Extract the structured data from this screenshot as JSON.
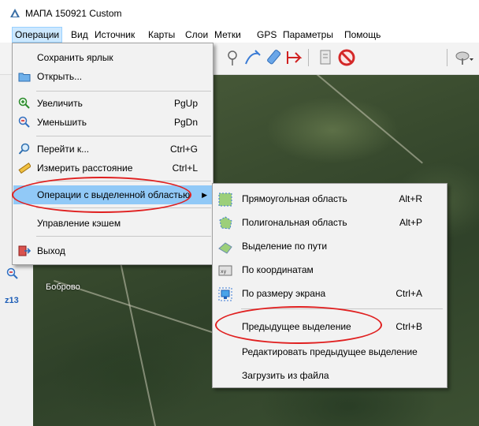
{
  "window": {
    "title": "МАПА 150921 Custom"
  },
  "menubar": {
    "items": [
      "Операции",
      "Вид",
      "Источник",
      "Карты",
      "Слои",
      "Метки",
      "GPS",
      "Параметры",
      "Помощь"
    ]
  },
  "toolbar": {
    "icons": [
      "pin-icon",
      "pen-route-icon",
      "highlighter-icon",
      "ruler-path-icon",
      "doc-icon",
      "no-icon",
      "satellite-icon"
    ]
  },
  "left_panel": {
    "zoom_label": "z13"
  },
  "map": {
    "place_label": "Боброво"
  },
  "operations_menu": {
    "items": [
      {
        "label": "Сохранить ярлык",
        "shortcut": "",
        "icon": ""
      },
      {
        "label": "Открыть...",
        "shortcut": "",
        "icon": "folder-icon"
      },
      {
        "label": "Увеличить",
        "shortcut": "PgUp",
        "icon": "zoom-in-icon"
      },
      {
        "label": "Уменьшить",
        "shortcut": "PgDn",
        "icon": "zoom-out-icon"
      },
      {
        "label": "Перейти к...",
        "shortcut": "Ctrl+G",
        "icon": "search-icon"
      },
      {
        "label": "Измерить расстояние",
        "shortcut": "Ctrl+L",
        "icon": "ruler-icon"
      },
      {
        "label": "Операции с выделенной областью",
        "shortcut": "",
        "icon": "",
        "submenu_arrow": "▶"
      },
      {
        "label": "Управление кэшем",
        "shortcut": "",
        "icon": ""
      },
      {
        "label": "Выход",
        "shortcut": "",
        "icon": "exit-icon"
      }
    ]
  },
  "selection_submenu": {
    "items": [
      {
        "label": "Прямоугольная область",
        "shortcut": "Alt+R",
        "icon": "rect-area-icon"
      },
      {
        "label": "Полигональная область",
        "shortcut": "Alt+P",
        "icon": "polygon-area-icon"
      },
      {
        "label": "Выделение по пути",
        "shortcut": "",
        "icon": "path-select-icon"
      },
      {
        "label": "По координатам",
        "shortcut": "",
        "icon": "coords-icon"
      },
      {
        "label": "По размеру экрана",
        "shortcut": "Ctrl+A",
        "icon": "screen-icon"
      },
      {
        "label": "Предыдущее выделение",
        "shortcut": "Ctrl+B",
        "icon": ""
      },
      {
        "label": "Редактировать предыдущее выделение",
        "shortcut": "",
        "icon": ""
      },
      {
        "label": "Загрузить из файла",
        "shortcut": "",
        "icon": ""
      }
    ]
  },
  "colors": {
    "menu_highlight": "#91c9f7",
    "annotation": "#e02020",
    "zoom_text": "#1f5fb7"
  }
}
